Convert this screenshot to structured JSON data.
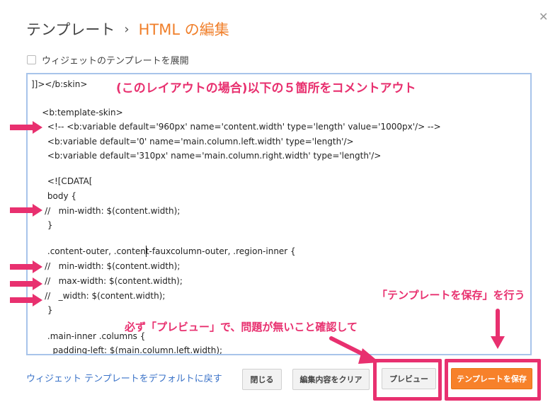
{
  "header": {
    "parent_label": "テンプレート",
    "separator": "›",
    "current_label": "HTML の編集",
    "close_glyph": "✕"
  },
  "expand_widgets": {
    "label": "ウィジェットのテンプレートを展開",
    "checked": false
  },
  "editor": {
    "lines": [
      "]]></b:skin>",
      "",
      "    <b:template-skin>",
      "      <!-- <b:variable default='960px' name='content.width' type='length' value='1000px'/> -->",
      "      <b:variable default='0' name='main.column.left.width' type='length'/>",
      "      <b:variable default='310px' name='main.column.right.width' type='length'/>",
      "",
      "      <![CDATA[",
      "      body {",
      "     //   min-width: $(content.width);",
      "      }",
      "",
      "      .content-outer, .content-fauxcolumn-outer, .region-inner {",
      "     //   min-width: $(content.width);",
      "     //   max-width: $(content.width);",
      "     //   _width: $(content.width);",
      "      }",
      "",
      "      .main-inner .columns {",
      "        padding-left: $(main.column.left.width);"
    ]
  },
  "annotations": {
    "comment_out": "(このレイアウトの場合)以下の５箇所をコメントアウト",
    "preview_note": "必ず「プレビュー」で、問題が無いこと確認して",
    "save_note": "「テンプレートを保存」を行う"
  },
  "footer": {
    "reset_link": "ウィジェット テンプレートをデフォルトに戻す",
    "close_button": "閉じる",
    "clear_button": "編集内容をクリア",
    "preview_button": "プレビュー",
    "save_button": "テンプレートを保存"
  },
  "colors": {
    "accent_orange": "#f7812a",
    "annotation_pink": "#e8306f",
    "link_blue": "#3b73c8",
    "editor_border": "#a8c4ea"
  }
}
